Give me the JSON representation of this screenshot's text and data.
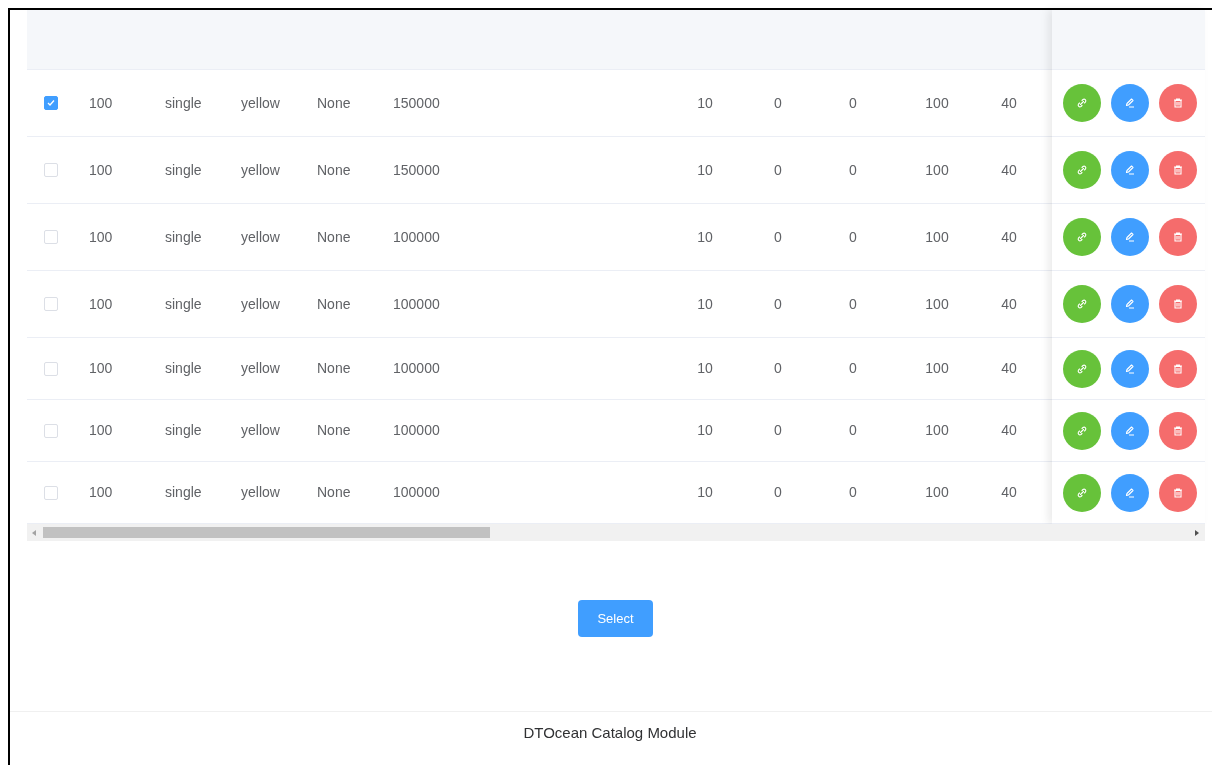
{
  "table": {
    "rows": [
      {
        "selected": true,
        "cells": [
          "100",
          "single",
          "yellow",
          "None",
          "150000",
          "10",
          "0",
          "0",
          "100",
          "40"
        ]
      },
      {
        "selected": false,
        "cells": [
          "100",
          "single",
          "yellow",
          "None",
          "150000",
          "10",
          "0",
          "0",
          "100",
          "40"
        ]
      },
      {
        "selected": false,
        "cells": [
          "100",
          "single",
          "yellow",
          "None",
          "100000",
          "10",
          "0",
          "0",
          "100",
          "40"
        ]
      },
      {
        "selected": false,
        "cells": [
          "100",
          "single",
          "yellow",
          "None",
          "100000",
          "10",
          "0",
          "0",
          "100",
          "40"
        ]
      },
      {
        "selected": false,
        "cells": [
          "100",
          "single",
          "yellow",
          "None",
          "100000",
          "10",
          "0",
          "0",
          "100",
          "40"
        ]
      },
      {
        "selected": false,
        "cells": [
          "100",
          "single",
          "yellow",
          "None",
          "100000",
          "10",
          "0",
          "0",
          "100",
          "40"
        ]
      },
      {
        "selected": false,
        "cells": [
          "100",
          "single",
          "yellow",
          "None",
          "100000",
          "10",
          "0",
          "0",
          "100",
          "40"
        ]
      }
    ],
    "actions": [
      {
        "kind": "link"
      },
      {
        "kind": "edit"
      },
      {
        "kind": "delete"
      }
    ]
  },
  "select_button": "Select",
  "footer": "DTOcean Catalog Module"
}
